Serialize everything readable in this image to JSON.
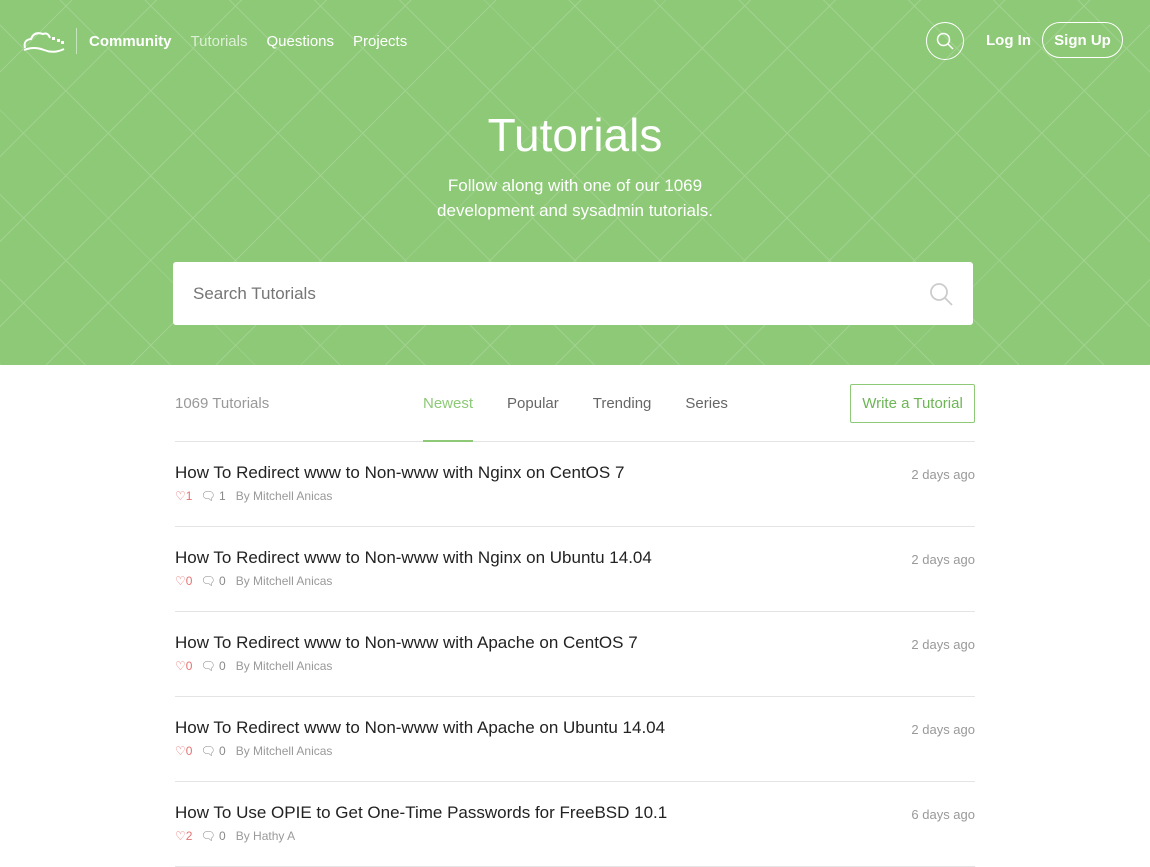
{
  "nav": {
    "community": "Community",
    "links": [
      "Tutorials",
      "Questions",
      "Projects"
    ],
    "login": "Log In",
    "signup": "Sign Up"
  },
  "hero": {
    "title": "Tutorials",
    "subtitle_line1": "Follow along with one of our 1069",
    "subtitle_line2": "development and sysadmin tutorials.",
    "search_placeholder": "Search Tutorials"
  },
  "toolbar": {
    "count": "1069 Tutorials",
    "tabs": [
      "Newest",
      "Popular",
      "Trending",
      "Series"
    ],
    "write": "Write a Tutorial"
  },
  "tutorials": [
    {
      "title": "How To Redirect www to Non-www with Nginx on CentOS 7",
      "likes": "1",
      "comments": "1",
      "author": "By Mitchell Anicas",
      "date": "2 days ago"
    },
    {
      "title": "How To Redirect www to Non-www with Nginx on Ubuntu 14.04",
      "likes": "0",
      "comments": "0",
      "author": "By Mitchell Anicas",
      "date": "2 days ago"
    },
    {
      "title": "How To Redirect www to Non-www with Apache on CentOS 7",
      "likes": "0",
      "comments": "0",
      "author": "By Mitchell Anicas",
      "date": "2 days ago"
    },
    {
      "title": "How To Redirect www to Non-www with Apache on Ubuntu 14.04",
      "likes": "0",
      "comments": "0",
      "author": "By Mitchell Anicas",
      "date": "2 days ago"
    },
    {
      "title": "How To Use OPIE to Get One-Time Passwords for FreeBSD 10.1",
      "likes": "2",
      "comments": "0",
      "author": "By Hathy A",
      "date": "6 days ago"
    }
  ]
}
